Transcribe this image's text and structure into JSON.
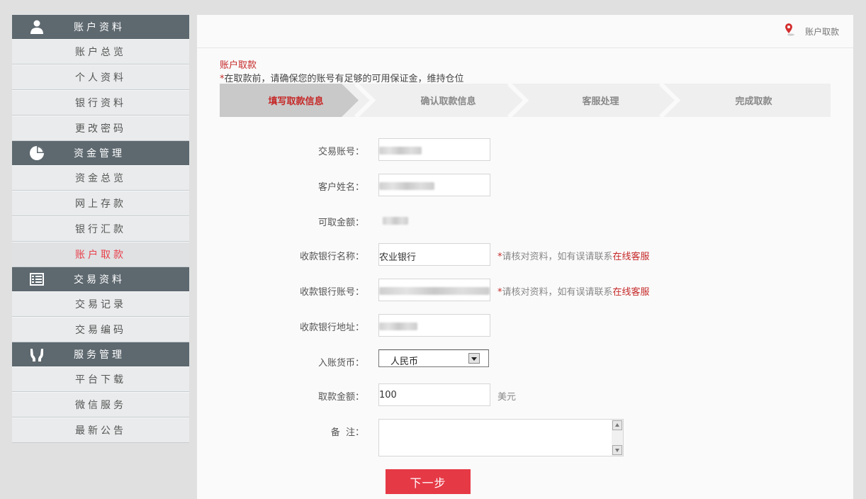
{
  "sidebar": {
    "sections": [
      {
        "title": "账户资料",
        "icon": "user-icon",
        "items": [
          "账户总览",
          "个人资料",
          "银行资料",
          "更改密码"
        ]
      },
      {
        "title": "资金管理",
        "icon": "pie-chart-icon",
        "items": [
          "资金总览",
          "网上存款",
          "银行汇款",
          "账户取款"
        ]
      },
      {
        "title": "交易资料",
        "icon": "list-icon",
        "items": [
          "交易记录",
          "交易编码"
        ]
      },
      {
        "title": "服务管理",
        "icon": "hands-icon",
        "items": [
          "平台下载",
          "微信服务",
          "最新公告"
        ]
      }
    ],
    "active_item": "账户取款"
  },
  "breadcrumb": {
    "current": "账户取款",
    "icon": "location-pin-icon"
  },
  "page": {
    "title": "账户取款",
    "note_star": "*",
    "note": "在取款前，请确保您的账号有足够的可用保证金，维持仓位"
  },
  "steps": [
    "填写取款信息",
    "确认取款信息",
    "客服处理",
    "完成取款"
  ],
  "form": {
    "account_label": "交易账号：",
    "name_label": "客户姓名：",
    "available_label": "可取金额：",
    "bank_name_label": "收款银行名称：",
    "bank_name_value": "农业银行",
    "bank_account_label": "收款银行账号：",
    "bank_address_label": "收款银行地址：",
    "currency_label": "入账货币：",
    "currency_value": "人民币",
    "amount_label": "取款金额：",
    "amount_value": "100",
    "amount_unit": "美元",
    "remark_label": "备  注：",
    "hint_star": "*",
    "hint_text": "请核对资料，如有误请联系",
    "hint_link": "在线客服",
    "next_label": "下一步"
  },
  "colors": {
    "accent": "#e63946",
    "sidebar_head": "#5d686f",
    "active_text": "#e8404a"
  }
}
